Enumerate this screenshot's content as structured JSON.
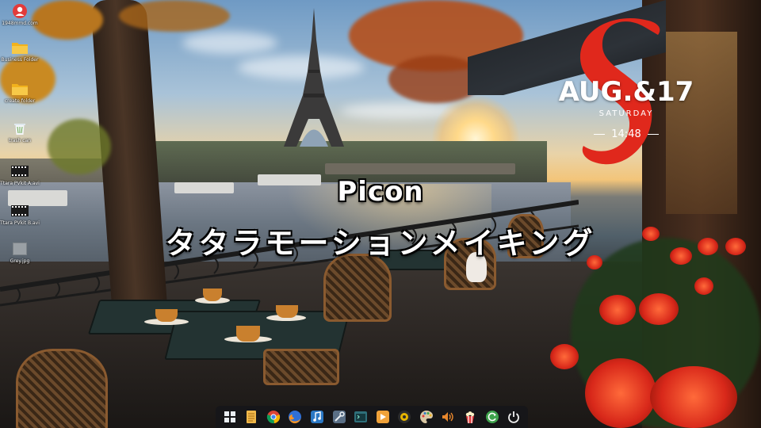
{
  "desktop": {
    "icons": [
      {
        "name": "user-icon",
        "label": "1948mmd.com"
      },
      {
        "name": "folder-icon",
        "label": "Business Folder"
      },
      {
        "name": "folder-icon",
        "label": "create folder"
      },
      {
        "name": "trash-icon",
        "label": "trash can"
      },
      {
        "name": "video-file-icon",
        "label": "Ttara PVkit A.avi"
      },
      {
        "name": "video-file-icon",
        "label": "Ttara PVkit B.avi"
      },
      {
        "name": "image-file-icon",
        "label": "Grey.jpg"
      }
    ]
  },
  "overlay": {
    "title": "Picon",
    "subtitle": "タタラモーションメイキング"
  },
  "date_widget": {
    "date": "AUG.&17",
    "weekday": "SATURDAY",
    "time": "14:48",
    "accent_color": "#e0281c"
  },
  "taskbar": {
    "items": [
      {
        "name": "start-menu-icon"
      },
      {
        "name": "file-manager-icon"
      },
      {
        "name": "chrome-browser-icon"
      },
      {
        "name": "firefox-browser-icon"
      },
      {
        "name": "music-player-icon"
      },
      {
        "name": "settings-tools-icon"
      },
      {
        "name": "terminal-icon"
      },
      {
        "name": "media-player-icon"
      },
      {
        "name": "app-launcher-icon"
      },
      {
        "name": "paint-palette-icon"
      },
      {
        "name": "volume-icon"
      },
      {
        "name": "popcorn-app-icon"
      },
      {
        "name": "refresh-sync-icon"
      },
      {
        "name": "power-icon"
      }
    ]
  }
}
